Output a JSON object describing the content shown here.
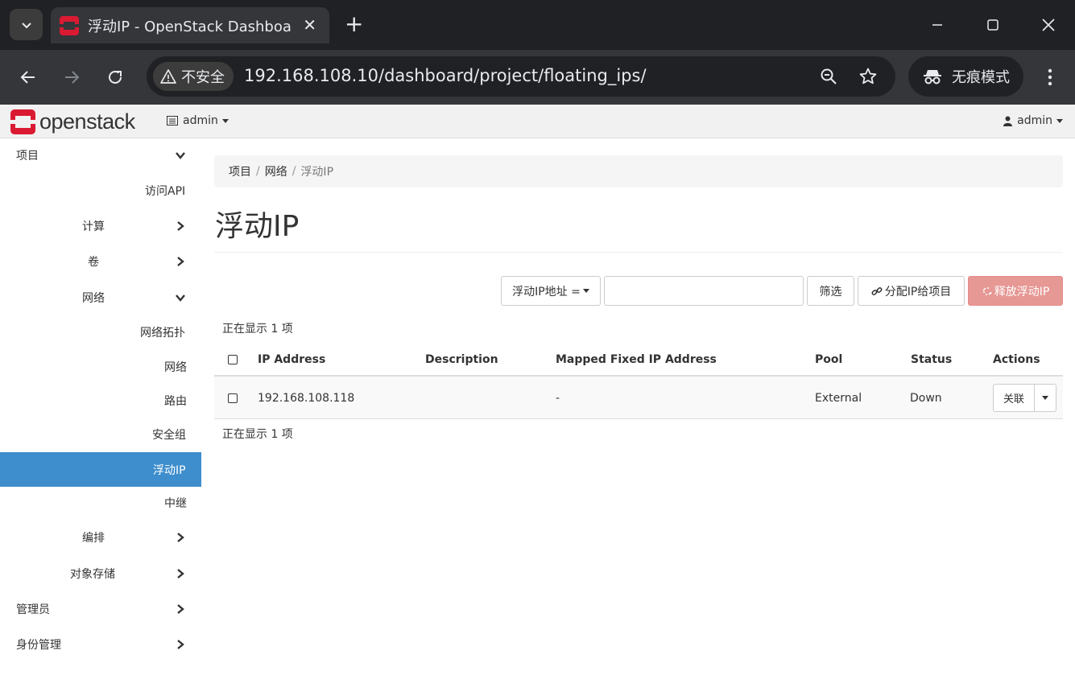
{
  "browser": {
    "tab_title": "浮动IP - OpenStack Dashboard",
    "security_label": "不安全",
    "url": "192.168.108.10/dashboard/project/floating_ips/",
    "incognito_label": "无痕模式"
  },
  "topnav": {
    "logo_text": "openstack",
    "project": "admin",
    "user": "admin"
  },
  "sidebar": {
    "project": "项目",
    "api_access": "访问API",
    "compute": "计算",
    "volumes": "卷",
    "network": "网络",
    "network_topology": "网络拓扑",
    "networks": "网络",
    "routers": "路由",
    "security_groups": "安全组",
    "floating_ips": "浮动IP",
    "trunks": "中继",
    "orchestration": "编排",
    "object_store": "对象存储",
    "admin": "管理员",
    "identity": "身份管理"
  },
  "breadcrumb": {
    "item1": "项目",
    "item2": "网络",
    "current": "浮动IP"
  },
  "page_title": "浮动IP",
  "filter": {
    "field_label": "浮动IP地址 =",
    "search_value": "",
    "filter_button": "筛选",
    "allocate_button": "分配IP给项目",
    "release_button": "释放浮动IP"
  },
  "table": {
    "count_top": "正在显示 1 项",
    "count_bottom": "正在显示 1 项",
    "headers": {
      "ip": "IP Address",
      "description": "Description",
      "mapped": "Mapped Fixed IP Address",
      "pool": "Pool",
      "status": "Status",
      "actions": "Actions"
    },
    "rows": [
      {
        "ip": "192.168.108.118",
        "description": "",
        "mapped": "-",
        "pool": "External",
        "status": "Down",
        "action": "关联"
      }
    ]
  },
  "colors": {
    "accent": "#3e8ecd",
    "danger_disabled": "#e69895",
    "brand_red": "#da1a32"
  }
}
